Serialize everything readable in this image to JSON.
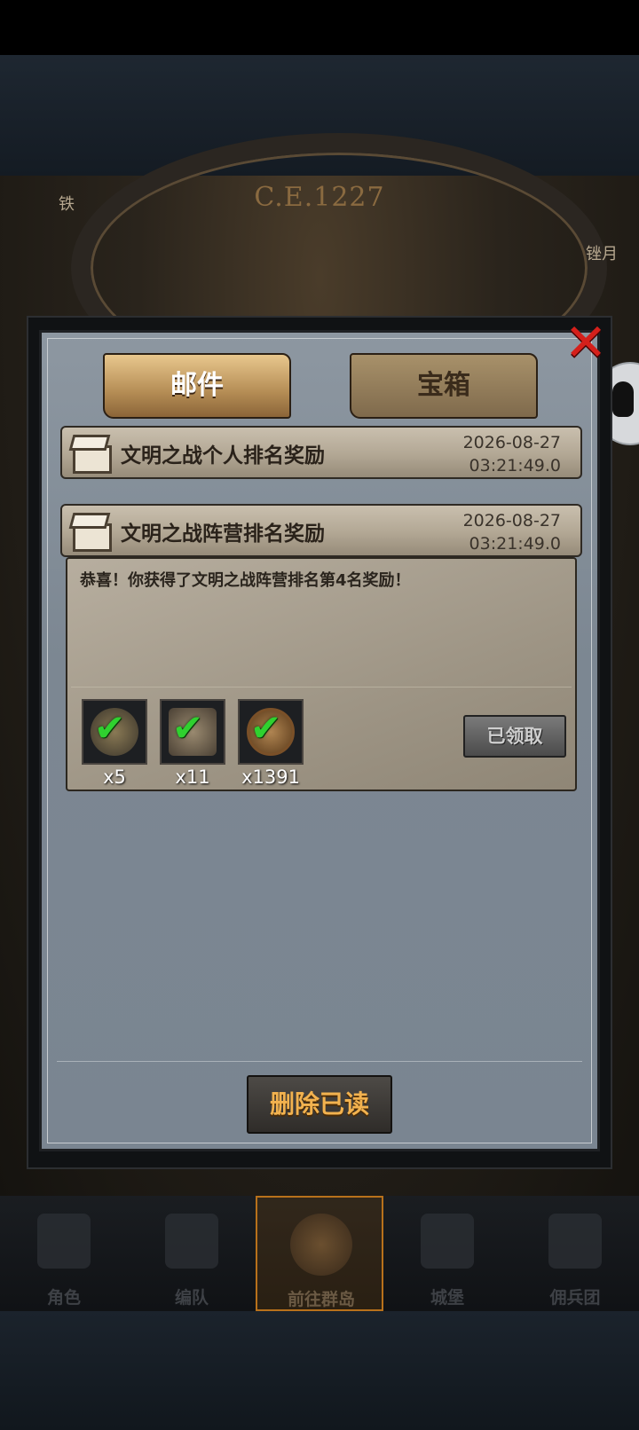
{
  "background": {
    "era_year": "C.E.1227",
    "left_label": "铁",
    "right_label": "锉月"
  },
  "mail_dialog": {
    "tabs": [
      {
        "label": "邮件",
        "active": true
      },
      {
        "label": "宝箱",
        "active": false
      }
    ],
    "close_icon": "close-x-icon",
    "mails": [
      {
        "title": "文明之战个人排名奖励",
        "date": "2026-08-27",
        "time": "03:21:49.0"
      },
      {
        "title": "文明之战阵营排名奖励",
        "date": "2026-08-27",
        "time": "03:21:49.0",
        "expanded": true,
        "body": "恭喜！你获得了文明之战阵营排名第4名奖励！",
        "rewards": [
          {
            "icon": "potion-gold-icon",
            "qty": "x5",
            "claimed": true
          },
          {
            "icon": "chest-bag-icon",
            "qty": "x11",
            "claimed": true
          },
          {
            "icon": "wood-token-icon",
            "qty": "x1391",
            "claimed": true
          }
        ],
        "claim_status": "已领取"
      }
    ],
    "delete_read_label": "删除已读"
  },
  "bottom_nav": [
    {
      "label": "角色",
      "icon": "knight-icon",
      "active": false
    },
    {
      "label": "编队",
      "icon": "helmet-icon",
      "active": false
    },
    {
      "label": "前往群岛",
      "icon": "compass-icon",
      "active": true
    },
    {
      "label": "城堡",
      "icon": "castle-icon",
      "active": false
    },
    {
      "label": "佣兵团",
      "icon": "ship-icon",
      "active": false
    }
  ],
  "colors": {
    "accent_orange": "#f2b24f",
    "check_green": "#2fd12f",
    "close_red": "#d5201b"
  }
}
